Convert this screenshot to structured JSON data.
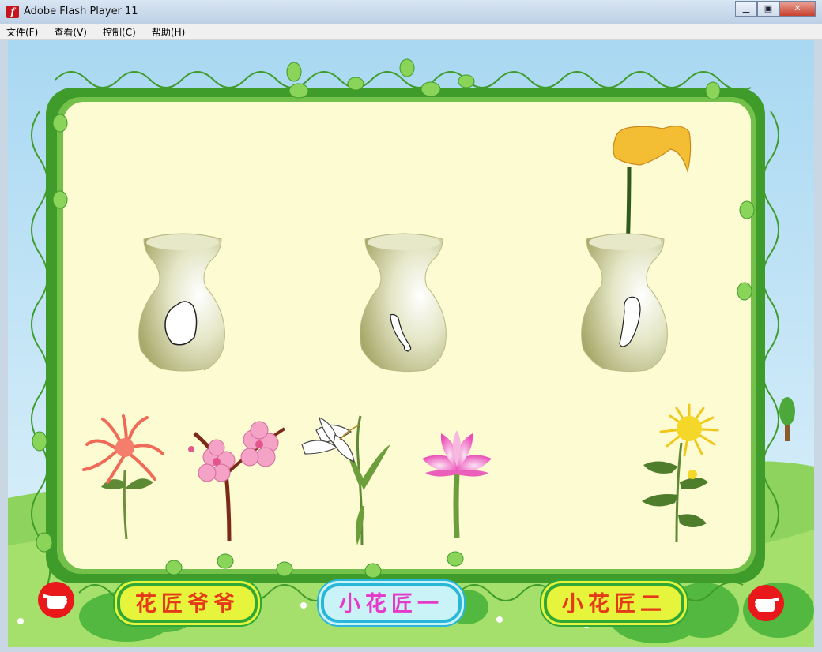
{
  "window": {
    "title": "Adobe Flash Player 11",
    "minimize": "▁",
    "restore": "▣",
    "close": "✕"
  },
  "menu": [
    {
      "label": "文件(F)"
    },
    {
      "label": "查看(V)"
    },
    {
      "label": "控制(C)"
    },
    {
      "label": "帮助(H)"
    }
  ],
  "game": {
    "buttons": {
      "grandpa": "花匠爷爷",
      "florist_one": "小花匠一",
      "florist_two": "小花匠二"
    },
    "vases": [
      {
        "petal": "round"
      },
      {
        "petal": "hook"
      },
      {
        "petal": "calla",
        "flower": "calla-lily"
      }
    ],
    "flowers": [
      "spider-chrysanthemum",
      "plum-blossom",
      "lily",
      "lotus",
      "yellow-chrysanthemum"
    ],
    "colors": {
      "frame": "#3f9c2a",
      "board": "#fdfbd2",
      "sky": "#b9dff5",
      "hand": "#e8181b"
    }
  }
}
